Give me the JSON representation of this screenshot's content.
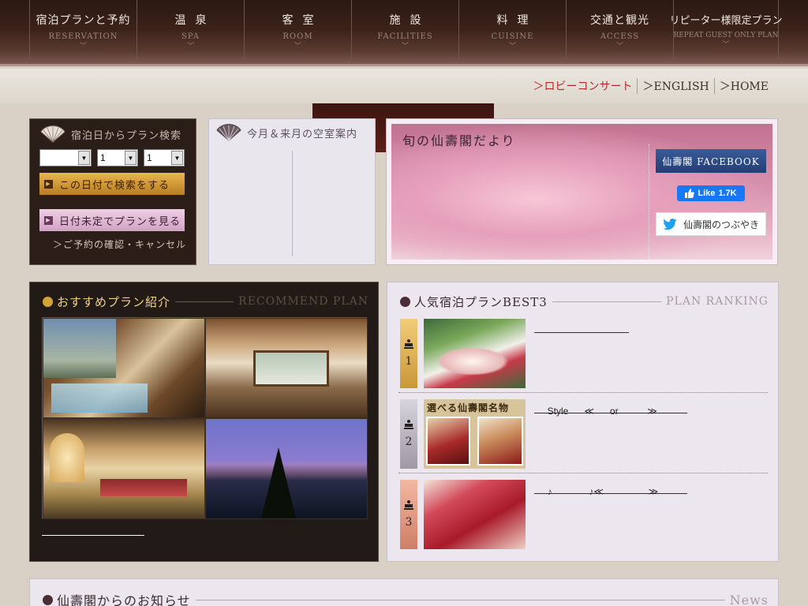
{
  "nav": [
    {
      "jp": "宿泊プランと予約",
      "en": "RESERVATION",
      "spaced": false
    },
    {
      "jp": "温泉",
      "en": "SPA",
      "spaced": true
    },
    {
      "jp": "客室",
      "en": "ROOM",
      "spaced": true
    },
    {
      "jp": "施設",
      "en": "FACILITIES",
      "spaced": true
    },
    {
      "jp": "料理",
      "en": "CUISINE",
      "spaced": true
    },
    {
      "jp": "交通と観光",
      "en": "ACCESS",
      "spaced": false
    },
    {
      "jp": "リピーター様限定プラン",
      "en": "REPEAT GUEST ONLY PLAN",
      "spaced": false
    }
  ],
  "sublinks": {
    "lobby": "＞ロビーコンサート",
    "english": "＞ENGLISH",
    "home": "＞HOME"
  },
  "search": {
    "title": "宿泊日からプラン検索",
    "select_month": "",
    "select_day": "1",
    "select_nights": "1",
    "search_btn": "この日付で検索をする",
    "undecided_btn": "日付未定でプランを見る",
    "confirm_link": "＞ご予約の確認・キャンセル"
  },
  "vacancy": {
    "title": "今月＆来月の空室案内"
  },
  "dayori": {
    "title": "旬の仙壽閣だより",
    "facebook_btn": "仙壽閣 FACEBOOK",
    "like_label": "Like",
    "like_count": "1.7K",
    "twitter_btn": "仙壽閣のつぶやき"
  },
  "recommend": {
    "title_jp": "おすすめプラン紹介",
    "title_en": "RECOMMEND PLAN"
  },
  "ranking": {
    "title_jp": "人気宿泊プランBEST3",
    "title_en": "PLAN RANKING",
    "rows": [
      {
        "rank": "1",
        "text": ""
      },
      {
        "rank": "2",
        "text": "     Style      ≪      or           ≫",
        "image_caption": "選べる仙壽閣名物"
      },
      {
        "rank": "3",
        "text": "     ♪              ♪≪                 ≫"
      }
    ]
  },
  "news": {
    "title_jp": "仙壽閣からのお知らせ",
    "title_en": "News"
  }
}
